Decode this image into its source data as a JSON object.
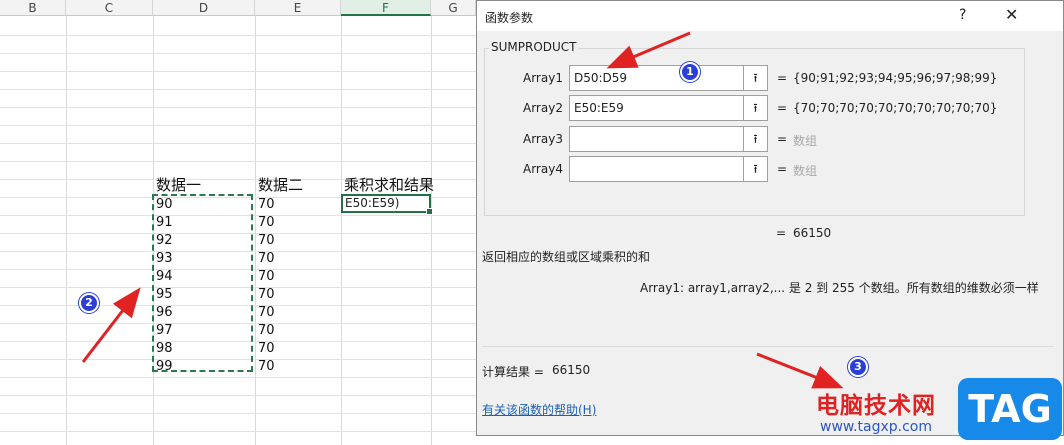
{
  "sheet": {
    "columns": [
      "B",
      "C",
      "D",
      "E",
      "F",
      "G"
    ],
    "headers": {
      "d": "数据一",
      "e": "数据二",
      "f": "乘积求和结果"
    },
    "d_values": [
      "90",
      "91",
      "92",
      "93",
      "94",
      "95",
      "96",
      "97",
      "98",
      "99"
    ],
    "e_values": [
      "70",
      "70",
      "70",
      "70",
      "70",
      "70",
      "70",
      "70",
      "70",
      "70"
    ],
    "active_cell_text": "E50:E59)"
  },
  "dialog": {
    "title": "函数参数",
    "help": "?",
    "close": "✕",
    "function_name": "SUMPRODUCT",
    "args": [
      {
        "label": "Array1",
        "value": "D50:D59",
        "result": "{90;91;92;93;94;95;96;97;98;99}"
      },
      {
        "label": "Array2",
        "value": "E50:E59",
        "result": "{70;70;70;70;70;70;70;70;70;70}"
      },
      {
        "label": "Array3",
        "value": "",
        "result": "数组"
      },
      {
        "label": "Array4",
        "value": "",
        "result": "数组"
      }
    ],
    "eq": "=",
    "collapse_glyph": "⭱",
    "result": "66150",
    "description": "返回相应的数组或区域乘积的和",
    "arg_description": "Array1:  array1,array2,... 是 2 到 255 个数组。所有数组的维数必须一样",
    "calc_label": "计算结果 =",
    "calc_value": "66150",
    "help_link": "有关该函数的帮助(H)"
  },
  "annotations": {
    "badge1": "1",
    "badge2": "2",
    "badge3": "3",
    "arrow_color": "#e02222",
    "badge_color": "#2a3fd6"
  },
  "watermark": {
    "cn": "电脑技术网",
    "url": "www.tagxp.com",
    "tag": "TAG"
  }
}
